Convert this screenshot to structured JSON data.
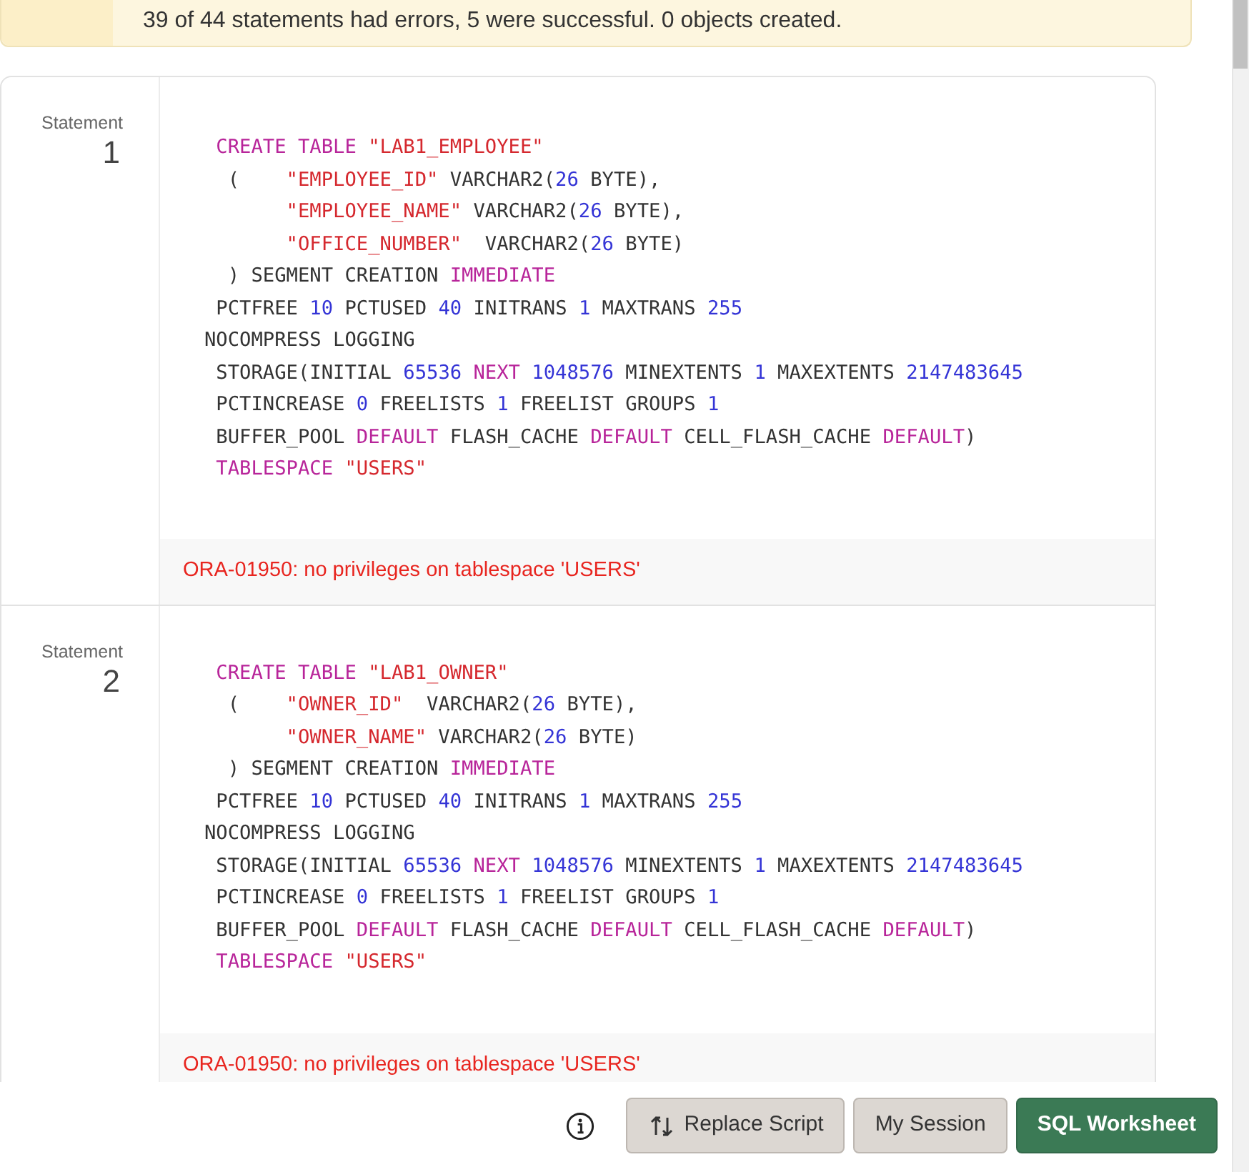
{
  "banner": {
    "message": "39 of 44 statements had errors, 5 were successful. 0 objects created."
  },
  "statements": [
    {
      "label": "Statement",
      "number": "1",
      "code": [
        [
          {
            "text": " CREATE",
            "kind": "keyword"
          },
          {
            "text": " TABLE",
            "kind": "keyword"
          },
          {
            "text": " \"LAB1_EMPLOYEE\"",
            "kind": "string"
          }
        ],
        [
          {
            "text": "  (    ",
            "kind": "plain"
          },
          {
            "text": "\"EMPLOYEE_ID\"",
            "kind": "string"
          },
          {
            "text": " VARCHAR2(",
            "kind": "plain"
          },
          {
            "text": "26",
            "kind": "number"
          },
          {
            "text": " BYTE),",
            "kind": "plain"
          }
        ],
        [
          {
            "text": "       \"EMPLOYEE_NAME\"",
            "kind": "string"
          },
          {
            "text": " VARCHAR2(",
            "kind": "plain"
          },
          {
            "text": "26",
            "kind": "number"
          },
          {
            "text": " BYTE),",
            "kind": "plain"
          }
        ],
        [
          {
            "text": "       \"OFFICE_NUMBER\"",
            "kind": "string"
          },
          {
            "text": "  VARCHAR2(",
            "kind": "plain"
          },
          {
            "text": "26",
            "kind": "number"
          },
          {
            "text": " BYTE)",
            "kind": "plain"
          }
        ],
        [
          {
            "text": "  ) SEGMENT CREATION ",
            "kind": "plain"
          },
          {
            "text": "IMMEDIATE",
            "kind": "keyword"
          }
        ],
        [
          {
            "text": " PCTFREE ",
            "kind": "plain"
          },
          {
            "text": "10",
            "kind": "number"
          },
          {
            "text": " PCTUSED ",
            "kind": "plain"
          },
          {
            "text": "40",
            "kind": "number"
          },
          {
            "text": " INITRANS ",
            "kind": "plain"
          },
          {
            "text": "1",
            "kind": "number"
          },
          {
            "text": " MAXTRANS ",
            "kind": "plain"
          },
          {
            "text": "255",
            "kind": "number"
          }
        ],
        [
          {
            "text": "NOCOMPRESS LOGGING",
            "kind": "plain"
          }
        ],
        [
          {
            "text": " STORAGE(INITIAL ",
            "kind": "plain"
          },
          {
            "text": "65536",
            "kind": "number"
          },
          {
            "text": " NEXT",
            "kind": "keyword"
          },
          {
            "text": " 1048576",
            "kind": "number"
          },
          {
            "text": " MINEXTENTS ",
            "kind": "plain"
          },
          {
            "text": "1",
            "kind": "number"
          },
          {
            "text": " MAXEXTENTS ",
            "kind": "plain"
          },
          {
            "text": "2147483645",
            "kind": "number"
          }
        ],
        [
          {
            "text": " PCTINCREASE ",
            "kind": "plain"
          },
          {
            "text": "0",
            "kind": "number"
          },
          {
            "text": " FREELISTS ",
            "kind": "plain"
          },
          {
            "text": "1",
            "kind": "number"
          },
          {
            "text": " FREELIST GROUPS ",
            "kind": "plain"
          },
          {
            "text": "1",
            "kind": "number"
          }
        ],
        [
          {
            "text": " BUFFER_POOL ",
            "kind": "plain"
          },
          {
            "text": "DEFAULT",
            "kind": "keyword"
          },
          {
            "text": " FLASH_CACHE ",
            "kind": "plain"
          },
          {
            "text": "DEFAULT",
            "kind": "keyword"
          },
          {
            "text": " CELL_FLASH_CACHE ",
            "kind": "plain"
          },
          {
            "text": "DEFAULT",
            "kind": "keyword"
          },
          {
            "text": ")",
            "kind": "plain"
          }
        ],
        [
          {
            "text": " TABLESPACE",
            "kind": "keyword"
          },
          {
            "text": " \"USERS\"",
            "kind": "string"
          }
        ]
      ],
      "error": "ORA-01950: no privileges on tablespace 'USERS'"
    },
    {
      "label": "Statement",
      "number": "2",
      "code": [
        [
          {
            "text": " CREATE",
            "kind": "keyword"
          },
          {
            "text": " TABLE",
            "kind": "keyword"
          },
          {
            "text": " \"LAB1_OWNER\"",
            "kind": "string"
          }
        ],
        [
          {
            "text": "  (    ",
            "kind": "plain"
          },
          {
            "text": "\"OWNER_ID\"",
            "kind": "string"
          },
          {
            "text": "  VARCHAR2(",
            "kind": "plain"
          },
          {
            "text": "26",
            "kind": "number"
          },
          {
            "text": " BYTE),",
            "kind": "plain"
          }
        ],
        [
          {
            "text": "       \"OWNER_NAME\"",
            "kind": "string"
          },
          {
            "text": " VARCHAR2(",
            "kind": "plain"
          },
          {
            "text": "26",
            "kind": "number"
          },
          {
            "text": " BYTE)",
            "kind": "plain"
          }
        ],
        [
          {
            "text": "  ) SEGMENT CREATION ",
            "kind": "plain"
          },
          {
            "text": "IMMEDIATE",
            "kind": "keyword"
          }
        ],
        [
          {
            "text": " PCTFREE ",
            "kind": "plain"
          },
          {
            "text": "10",
            "kind": "number"
          },
          {
            "text": " PCTUSED ",
            "kind": "plain"
          },
          {
            "text": "40",
            "kind": "number"
          },
          {
            "text": " INITRANS ",
            "kind": "plain"
          },
          {
            "text": "1",
            "kind": "number"
          },
          {
            "text": " MAXTRANS ",
            "kind": "plain"
          },
          {
            "text": "255",
            "kind": "number"
          }
        ],
        [
          {
            "text": "NOCOMPRESS LOGGING",
            "kind": "plain"
          }
        ],
        [
          {
            "text": " STORAGE(INITIAL ",
            "kind": "plain"
          },
          {
            "text": "65536",
            "kind": "number"
          },
          {
            "text": " NEXT",
            "kind": "keyword"
          },
          {
            "text": " 1048576",
            "kind": "number"
          },
          {
            "text": " MINEXTENTS ",
            "kind": "plain"
          },
          {
            "text": "1",
            "kind": "number"
          },
          {
            "text": " MAXEXTENTS ",
            "kind": "plain"
          },
          {
            "text": "2147483645",
            "kind": "number"
          }
        ],
        [
          {
            "text": " PCTINCREASE ",
            "kind": "plain"
          },
          {
            "text": "0",
            "kind": "number"
          },
          {
            "text": " FREELISTS ",
            "kind": "plain"
          },
          {
            "text": "1",
            "kind": "number"
          },
          {
            "text": " FREELIST GROUPS ",
            "kind": "plain"
          },
          {
            "text": "1",
            "kind": "number"
          }
        ],
        [
          {
            "text": " BUFFER_POOL ",
            "kind": "plain"
          },
          {
            "text": "DEFAULT",
            "kind": "keyword"
          },
          {
            "text": " FLASH_CACHE ",
            "kind": "plain"
          },
          {
            "text": "DEFAULT",
            "kind": "keyword"
          },
          {
            "text": " CELL_FLASH_CACHE ",
            "kind": "plain"
          },
          {
            "text": "DEFAULT",
            "kind": "keyword"
          },
          {
            "text": ")",
            "kind": "plain"
          }
        ],
        [
          {
            "text": " TABLESPACE",
            "kind": "keyword"
          },
          {
            "text": " \"USERS\"",
            "kind": "string"
          }
        ]
      ],
      "error": "ORA-01950: no privileges on tablespace 'USERS'"
    }
  ],
  "footer": {
    "buttons": [
      {
        "label": "Replace Script",
        "kind": "secondary_icon"
      },
      {
        "label": "My Session",
        "kind": "secondary"
      },
      {
        "label": "SQL Worksheet",
        "kind": "primary"
      }
    ]
  }
}
